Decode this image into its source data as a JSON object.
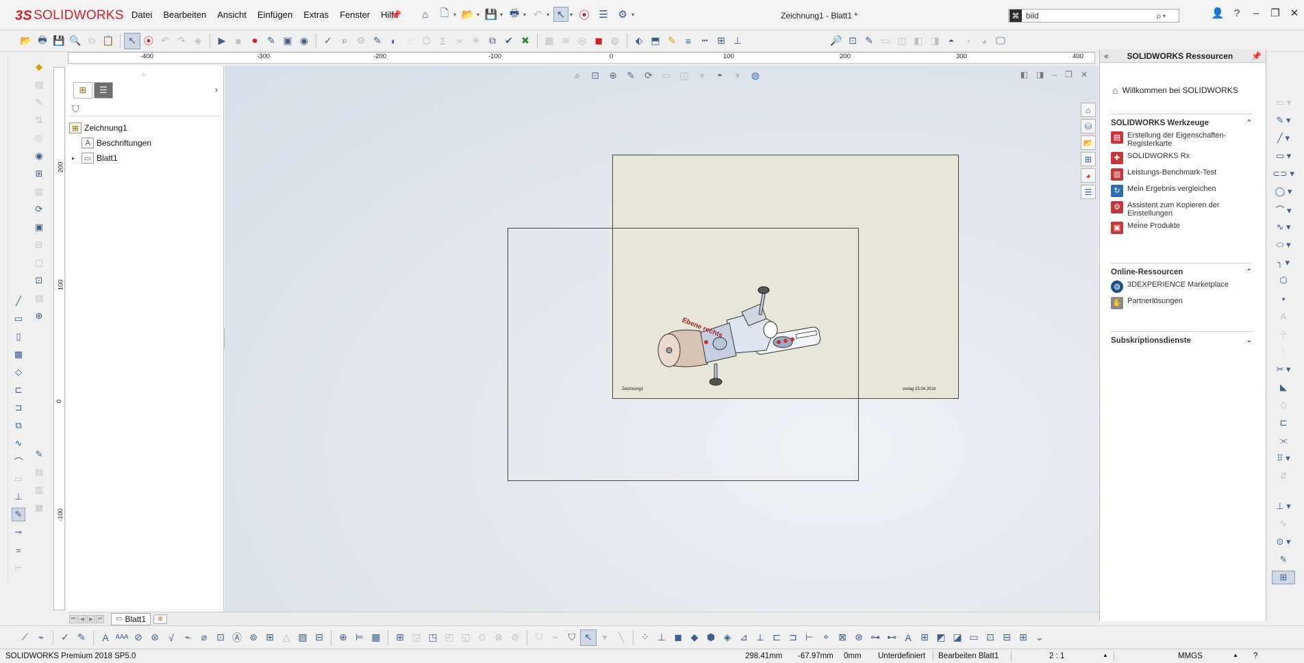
{
  "app": {
    "logo_prefix": "3S",
    "logo_text": "SOLIDWORKS",
    "document_title": "Zeichnung1 - Blatt1 *"
  },
  "menu": [
    "Datei",
    "Bearbeiten",
    "Ansicht",
    "Einfügen",
    "Extras",
    "Fenster",
    "Hilfe"
  ],
  "search": {
    "value": "bild",
    "placeholder": ""
  },
  "ruler": {
    "h_ticks": [
      "-400",
      "-300",
      "-200",
      "-100",
      "0",
      "100",
      "200",
      "300",
      "400"
    ],
    "v_ticks": [
      "200",
      "100",
      "0",
      "-100"
    ]
  },
  "feature_tree": {
    "items": [
      {
        "label": "Zeichnung1"
      },
      {
        "label": "Beschriftungen"
      },
      {
        "label": "Blatt1"
      }
    ]
  },
  "drawing": {
    "plane_label": "Ebene rechts",
    "sheet_label_left": "Zeichnung1",
    "sheet_label_right": "vorlag 15.04.2018"
  },
  "task_pane": {
    "title": "SOLIDWORKS Ressourcen",
    "welcome": "Willkommen bei SOLIDWORKS",
    "sections": [
      {
        "title": "SOLIDWORKS Werkzeuge",
        "items": [
          "Erstellung der Eigenschaften-Registerkarte",
          "SOLIDWORKS Rx",
          "Leistungs-Benchmark-Test",
          "Mein Ergebnis vergleichen",
          "Assistent zum Kopieren der Einstellungen",
          "Meine Produkte"
        ]
      },
      {
        "title": "Online-Ressourcen",
        "items": [
          "3DEXPERIENCE Marketplace",
          "Partnerlösungen"
        ]
      },
      {
        "title": "Subskriptionsdienste",
        "items": []
      }
    ]
  },
  "sheet_tabs": {
    "active": "Blatt1"
  },
  "status": {
    "product": "SOLIDWORKS Premium 2018 SP5.0",
    "x": "298.41mm",
    "y": "-67.97mm",
    "z": "0mm",
    "state": "Unterdefiniert",
    "mode": "Bearbeiten Blatt1",
    "scale": "2 : 1",
    "units": "MMGS"
  }
}
